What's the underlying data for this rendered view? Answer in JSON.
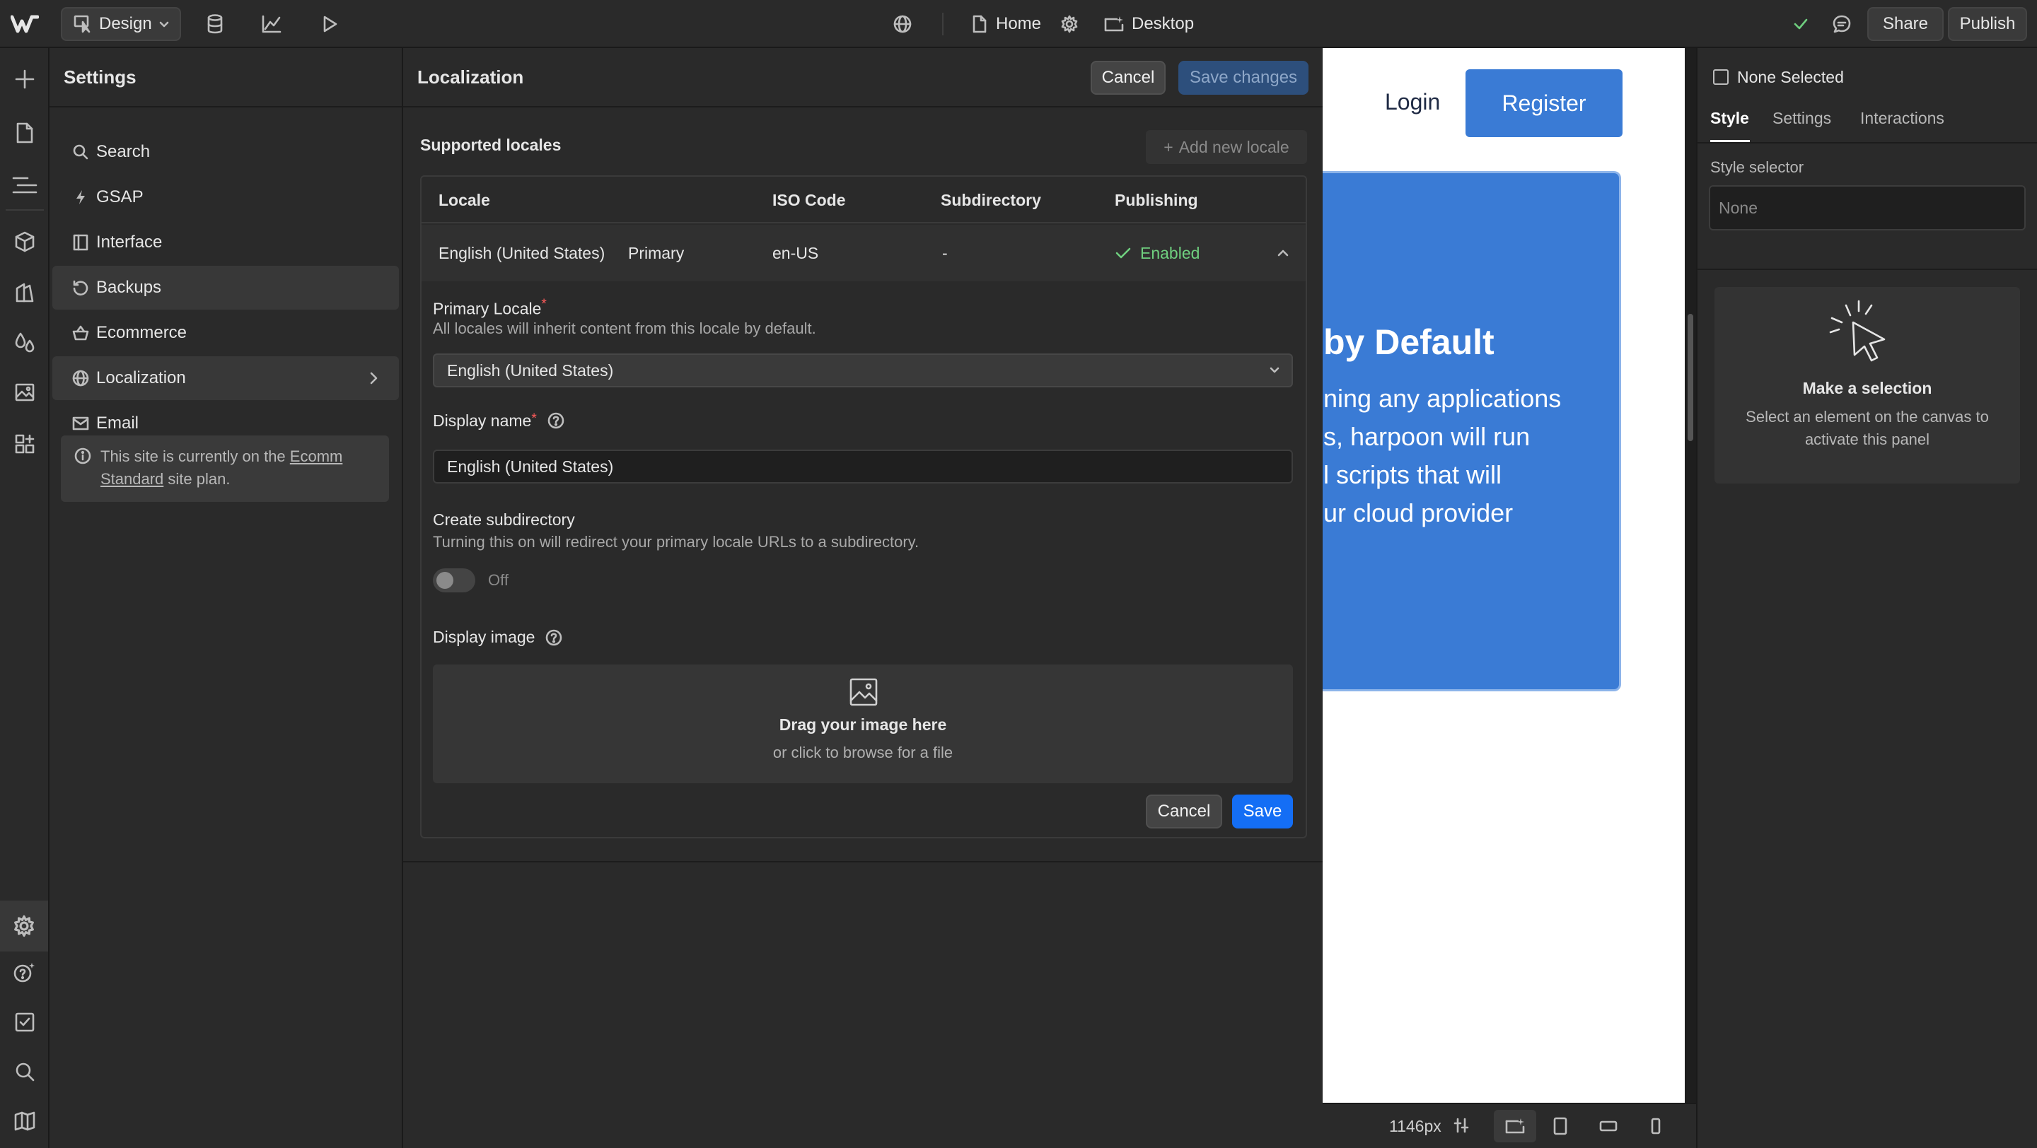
{
  "topbar": {
    "mode_label": "Design",
    "page_label": "Home",
    "breakpoint_label": "Desktop",
    "share_label": "Share",
    "publish_label": "Publish"
  },
  "settings": {
    "title": "Settings",
    "items": [
      {
        "label": "Search",
        "icon": "search-icon"
      },
      {
        "label": "GSAP",
        "icon": "bolt-icon"
      },
      {
        "label": "Interface",
        "icon": "layout-icon"
      },
      {
        "label": "Backups",
        "icon": "restore-icon"
      },
      {
        "label": "Ecommerce",
        "icon": "basket-icon"
      },
      {
        "label": "Localization",
        "icon": "globe-icon"
      },
      {
        "label": "Email",
        "icon": "mail-icon"
      }
    ],
    "plan_notice": {
      "prefix": "This site is currently on the",
      "link_line1": "Ecomm",
      "link_line2": "Standard",
      "suffix": "site plan."
    }
  },
  "localization": {
    "title": "Localization",
    "cancel_label": "Cancel",
    "save_changes_label": "Save changes",
    "supported_locales_title": "Supported locales",
    "add_locale_label": "Add new locale",
    "table": {
      "headers": [
        "Locale",
        "ISO Code",
        "Subdirectory",
        "Publishing"
      ],
      "rows": [
        {
          "locale": "English (United States)",
          "tag": "Primary",
          "iso": "en-US",
          "subdirectory": "-",
          "publishing": "Enabled"
        }
      ]
    },
    "primary_locale": {
      "label": "Primary Locale",
      "required_mark": "*",
      "help": "All locales will inherit content from this locale by default.",
      "value": "English (United States)"
    },
    "display_name": {
      "label": "Display name",
      "required_mark": "*",
      "value": "English (United States)"
    },
    "subdirectory": {
      "label": "Create subdirectory",
      "help": "Turning this on will redirect your primary locale URLs to a subdirectory.",
      "state": "Off"
    },
    "display_image": {
      "label": "Display image",
      "drop_title": "Drag your image here",
      "drop_sub": "or click to browse for a file"
    },
    "form_cancel_label": "Cancel",
    "form_save_label": "Save"
  },
  "canvas": {
    "login_label": "Login",
    "register_label": "Register",
    "heading_fragment": "by Default",
    "body_lines": [
      "ning any applications",
      "s, harpoon will run",
      "l scripts that will",
      "ur cloud provider"
    ],
    "width_readout": "1146px"
  },
  "right_panel": {
    "none_selected": "None Selected",
    "tabs": [
      "Style",
      "Settings",
      "Interactions"
    ],
    "style_selector_label": "Style selector",
    "style_selector_placeholder": "None",
    "empty_title": "Make a selection",
    "empty_desc": "Select an element on the canvas to activate this panel"
  },
  "colors": {
    "accent": "#146ef5",
    "enabled_green": "#6fcf7f",
    "canvas_card": "#3a7bd5"
  }
}
